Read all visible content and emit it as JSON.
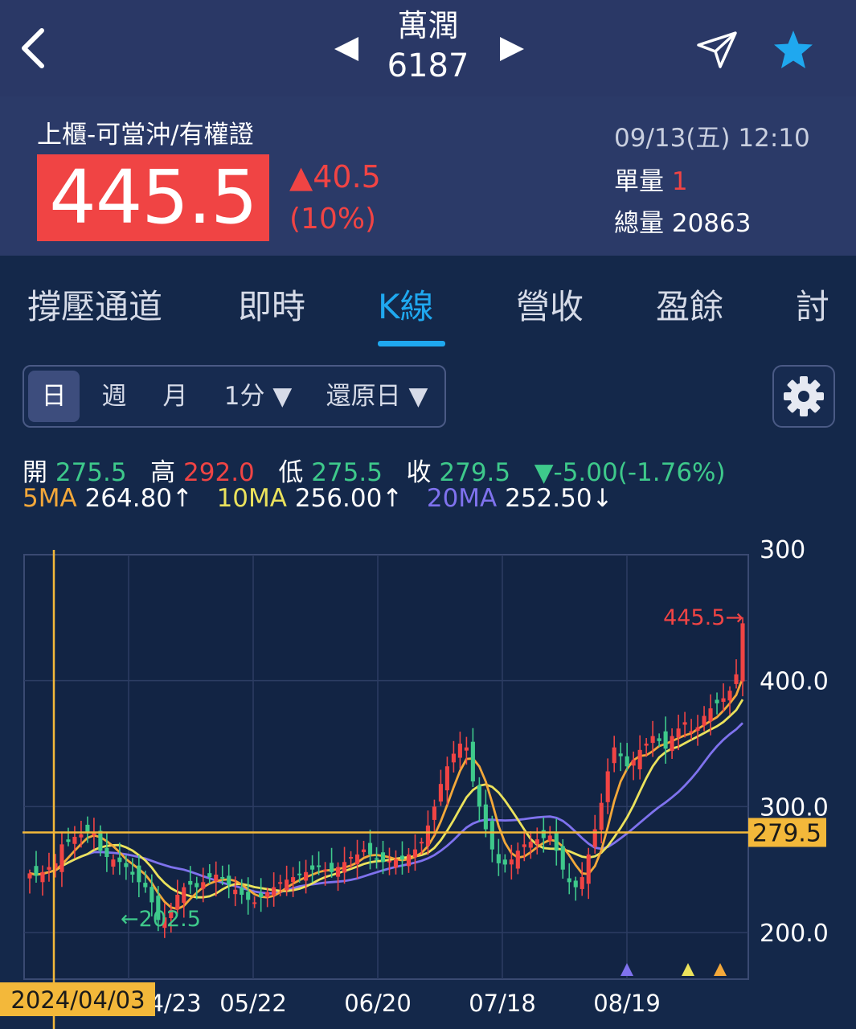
{
  "header": {
    "stock_name": "萬潤",
    "stock_code": "6187"
  },
  "quote": {
    "market": "上櫃-可當沖/有權證",
    "price": "445.5",
    "change": "▲40.5",
    "change_pct": "(10%)",
    "datetime": "09/13(五) 12:10",
    "unit_vol_label": "單量",
    "unit_vol": "1",
    "total_vol_label": "總量",
    "total_vol": "20863"
  },
  "tabs": [
    "撐壓通道",
    "即時",
    "K線",
    "營收",
    "盈餘",
    "討"
  ],
  "active_tab": "K線",
  "period_selector": {
    "items": [
      "日",
      "週",
      "月",
      "1分 ▼",
      "還原日 ▼"
    ],
    "active": "日"
  },
  "ohlc": {
    "open_label": "開",
    "open": "275.5",
    "high_label": "高",
    "high": "292.0",
    "low_label": "低",
    "low": "275.5",
    "close_label": "收",
    "close": "279.5",
    "change": "▼-5.00(-1.76%)"
  },
  "ma": {
    "ma5_label": "5MA",
    "ma5": "264.80↑",
    "ma10_label": "10MA",
    "ma10": "256.00↑",
    "ma20_label": "20MA",
    "ma20": "252.50↓"
  },
  "colors": {
    "up": "#f04444",
    "down": "#3ec98b",
    "accent": "#1fa8ef",
    "ma5": "#f3a83a",
    "ma10": "#ebe25c",
    "ma20": "#7f72ee",
    "crosshair": "#f3b83a"
  },
  "chart_data": {
    "type": "candlestick",
    "y_tick_labels": [
      "300",
      "400.0",
      "300.0",
      "200.0"
    ],
    "x_tick_labels": [
      "4/23",
      "05/22",
      "06/20",
      "07/18",
      "08/19"
    ],
    "crosshair_date": "2024/04/03",
    "crosshair_price": "279.5",
    "last_price_label": "445.5→",
    "min_label": "←202.5",
    "ylim": [
      163,
      500
    ],
    "close": [
      247,
      245,
      248,
      252,
      255,
      270,
      272,
      276,
      278,
      280,
      279.5,
      265,
      260,
      258,
      256,
      252,
      246,
      240,
      236,
      224,
      210,
      212,
      218,
      230,
      236,
      238,
      236,
      240,
      244,
      246,
      243,
      238,
      234,
      230,
      226,
      224,
      228,
      232,
      236,
      240,
      242,
      244,
      246,
      248,
      250,
      252,
      250,
      248,
      252,
      256,
      260,
      262,
      266,
      262,
      258,
      256,
      257,
      258,
      258,
      262,
      266,
      272,
      285,
      300,
      318,
      332,
      342,
      350,
      347,
      320,
      300,
      282,
      266,
      255,
      254,
      258,
      265,
      270,
      272,
      274,
      275,
      277,
      265,
      250,
      240,
      236,
      244,
      262,
      282,
      303,
      328,
      347,
      340,
      332,
      337,
      345,
      350,
      356,
      352,
      346,
      356,
      362,
      367,
      360,
      363,
      372,
      378,
      382,
      386,
      392,
      405,
      445.5
    ],
    "ma5": [],
    "ma10": [],
    "ma20": []
  }
}
